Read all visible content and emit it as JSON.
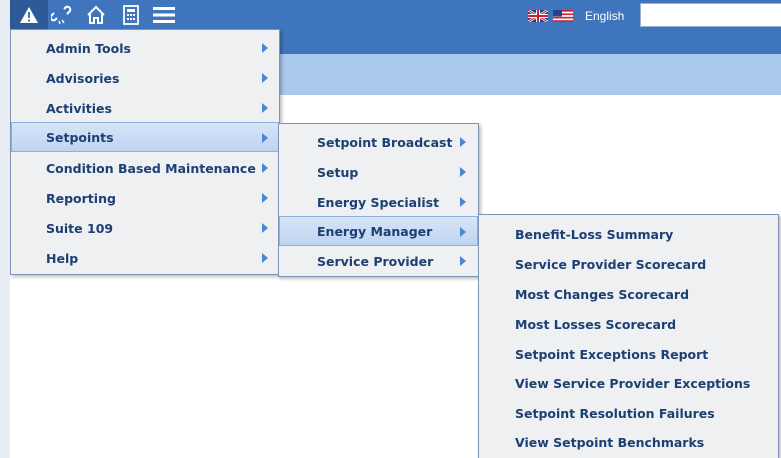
{
  "toolbar": {
    "icons": [
      "warning-icon",
      "link-icon",
      "home-icon",
      "calculator-icon",
      "menu-icon"
    ],
    "language_label": "English",
    "search_value": ""
  },
  "menus": {
    "main": [
      {
        "label": "Admin Tools"
      },
      {
        "label": "Advisories"
      },
      {
        "label": "Activities"
      },
      {
        "label": "Setpoints"
      },
      {
        "label": "Condition Based Maintenance"
      },
      {
        "label": "Reporting"
      },
      {
        "label": "Suite 109"
      },
      {
        "label": "Help"
      }
    ],
    "setpoints": [
      {
        "label": "Setpoint Broadcast"
      },
      {
        "label": "Setup"
      },
      {
        "label": "Energy Specialist"
      },
      {
        "label": "Energy Manager"
      },
      {
        "label": "Service Provider"
      }
    ],
    "energy_manager": [
      {
        "label": "Benefit-Loss Summary"
      },
      {
        "label": "Service Provider Scorecard"
      },
      {
        "label": "Most Changes Scorecard"
      },
      {
        "label": "Most Losses Scorecard"
      },
      {
        "label": "Setpoint Exceptions Report"
      },
      {
        "label": "View Service Provider Exceptions"
      },
      {
        "label": "Setpoint Resolution Failures"
      },
      {
        "label": "View Setpoint Benchmarks"
      }
    ]
  },
  "colors": {
    "toolbar_bg": "#3f75bd",
    "band_bg": "#a9c9ec",
    "menu_bg": "#eef0f2",
    "menu_text": "#1d3f73",
    "arrow": "#4a86d4"
  }
}
